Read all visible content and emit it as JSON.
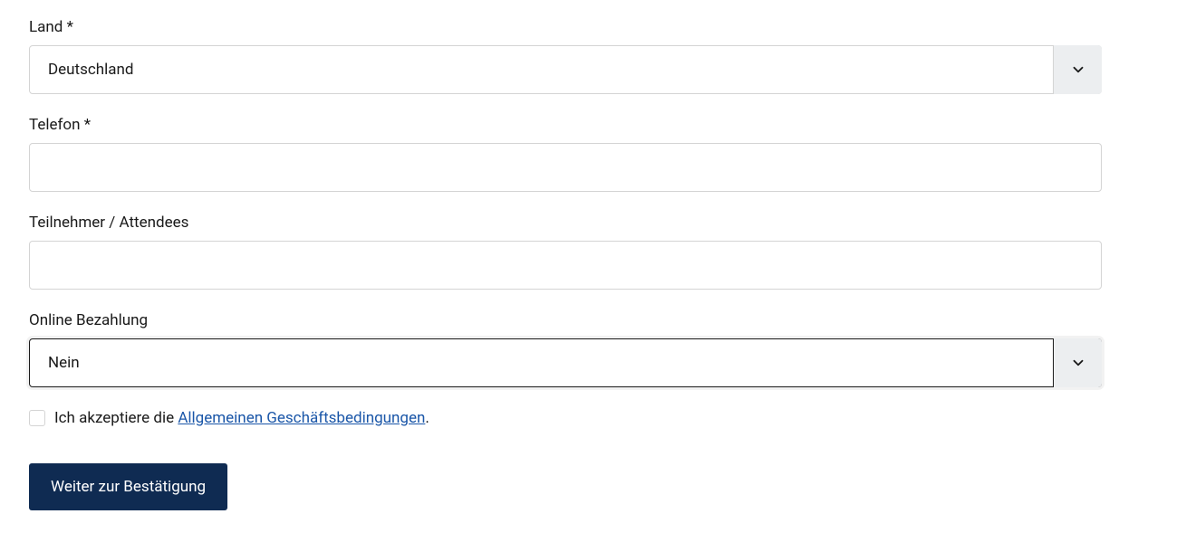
{
  "form": {
    "country": {
      "label": "Land *",
      "value": "Deutschland"
    },
    "phone": {
      "label": "Telefon *",
      "value": ""
    },
    "attendees": {
      "label": "Teilnehmer / Attendees",
      "value": ""
    },
    "onlinePayment": {
      "label": "Online Bezahlung",
      "value": "Nein"
    },
    "terms": {
      "prefix": "Ich akzeptiere die ",
      "linkText": "Allgemeinen Geschäftsbedingungen",
      "suffix": "."
    },
    "submitLabel": "Weiter zur Bestätigung"
  }
}
